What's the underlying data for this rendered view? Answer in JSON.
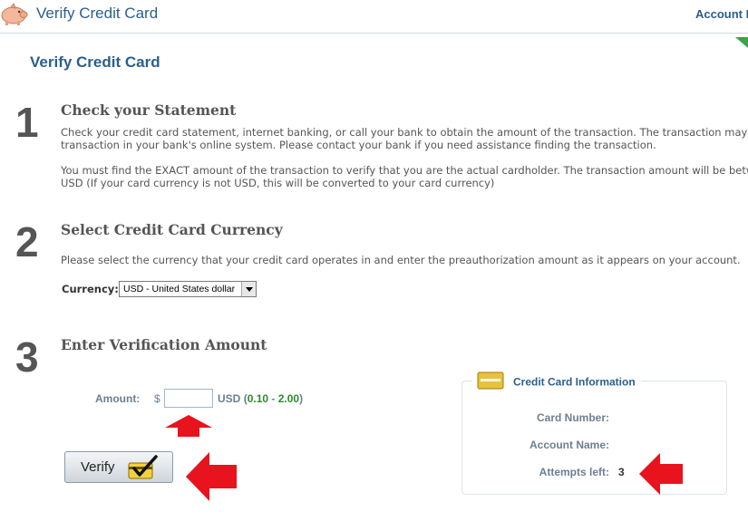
{
  "header": {
    "title": "Verify Credit Card",
    "account_link": "Account I"
  },
  "page": {
    "heading": "Verify Credit Card"
  },
  "steps": [
    {
      "number": "1",
      "title": "Check your Statement",
      "paragraphs": [
        "Check your credit card statement, internet banking, or call your bank to obtain the amount of the transaction. The transaction may appea",
        "transaction in your bank's online system. Please contact your bank if you need assistance finding the transaction.",
        "You must find the EXACT amount of the transaction to verify that you are the actual cardholder. The transaction amount will be between",
        "USD (If your card currency is not USD, this will be converted to your card currency)"
      ]
    },
    {
      "number": "2",
      "title": "Select Credit Card Currency",
      "paragraphs": [
        "Please select the currency that your credit card operates in and enter the preauthorization amount as it appears on your account."
      ]
    },
    {
      "number": "3",
      "title": "Enter Verification Amount"
    }
  ],
  "currency": {
    "label": "Currency:",
    "selected": "USD - United States dollar"
  },
  "amount": {
    "label": "Amount:",
    "symbol": "$",
    "value": "",
    "unit": "USD",
    "open_paren": "(",
    "min": "0.10",
    "separator": " - ",
    "max": "2.00",
    "close_paren": ")"
  },
  "verify_button": {
    "label": "Verify",
    "icon": "checkmark-card-icon"
  },
  "card_info": {
    "title": "Credit Card Information",
    "icon": "credit-card-icon",
    "card_number_label": "Card Number:",
    "card_number_value": "",
    "account_name_label": "Account Name:",
    "account_name_value": "",
    "attempts_label": "Attempts left:",
    "attempts_value": "3"
  },
  "colors": {
    "accent": "#2b5f8e",
    "annotation_arrow": "#e8131c",
    "range_green": "#2c8a2c"
  }
}
